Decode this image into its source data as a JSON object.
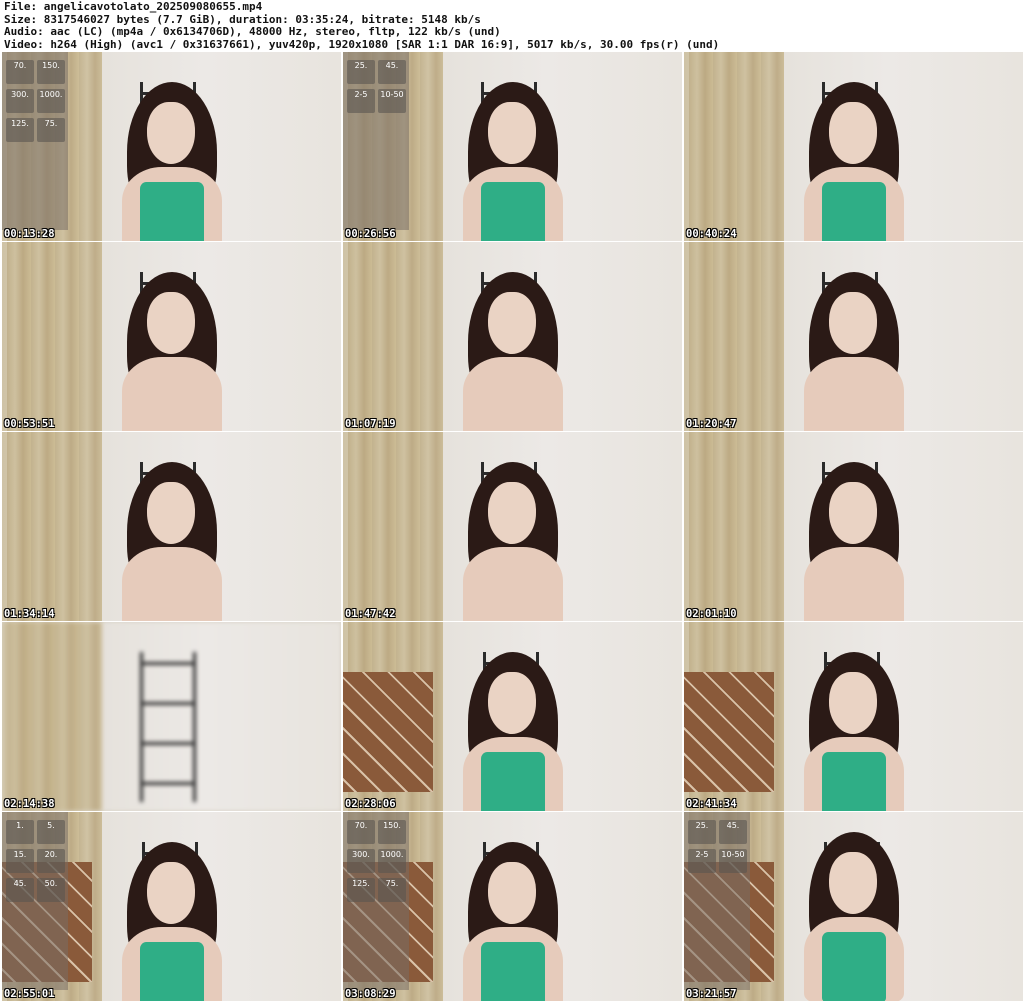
{
  "header": {
    "file": "File: angelicavotolato_202509080655.mp4",
    "size": "Size: 8317546027 bytes (7.7 GiB), duration: 03:35:24, bitrate: 5148 kb/s",
    "audio": "Audio: aac (LC) (mp4a / 0x6134706D), 48000 Hz, stereo, fltp, 122 kb/s (und)",
    "video": "Video: h264 (High) (avc1 / 0x31637661), yuv420p, 1920x1080 [SAR 1:1 DAR 16:9], 5017 kb/s, 30.00 fps(r) (und)"
  },
  "thumbnails": [
    {
      "time": "00:13:28"
    },
    {
      "time": "00:26:56"
    },
    {
      "time": "00:40:24"
    },
    {
      "time": "00:53:51"
    },
    {
      "time": "01:07:19"
    },
    {
      "time": "01:20:47"
    },
    {
      "time": "01:34:14"
    },
    {
      "time": "01:47:42"
    },
    {
      "time": "02:01:10"
    },
    {
      "time": "02:14:38"
    },
    {
      "time": "02:28:06"
    },
    {
      "time": "02:41:34"
    },
    {
      "time": "02:55:01"
    },
    {
      "time": "03:08:29"
    },
    {
      "time": "03:21:57"
    }
  ],
  "overlay_tiles": {
    "t0": [
      "70.",
      "150.",
      "300.",
      "1000.",
      "125.",
      "75."
    ],
    "t1": [
      "25.",
      "45.",
      "2-5",
      "10-50"
    ],
    "t12": [
      "1.",
      "5.",
      "15.",
      "20.",
      "45.",
      "50."
    ],
    "t13": [
      "70.",
      "150.",
      "300.",
      "1000.",
      "125.",
      "75."
    ],
    "t14": [
      "25.",
      "45.",
      "2-5",
      "10-50"
    ]
  }
}
